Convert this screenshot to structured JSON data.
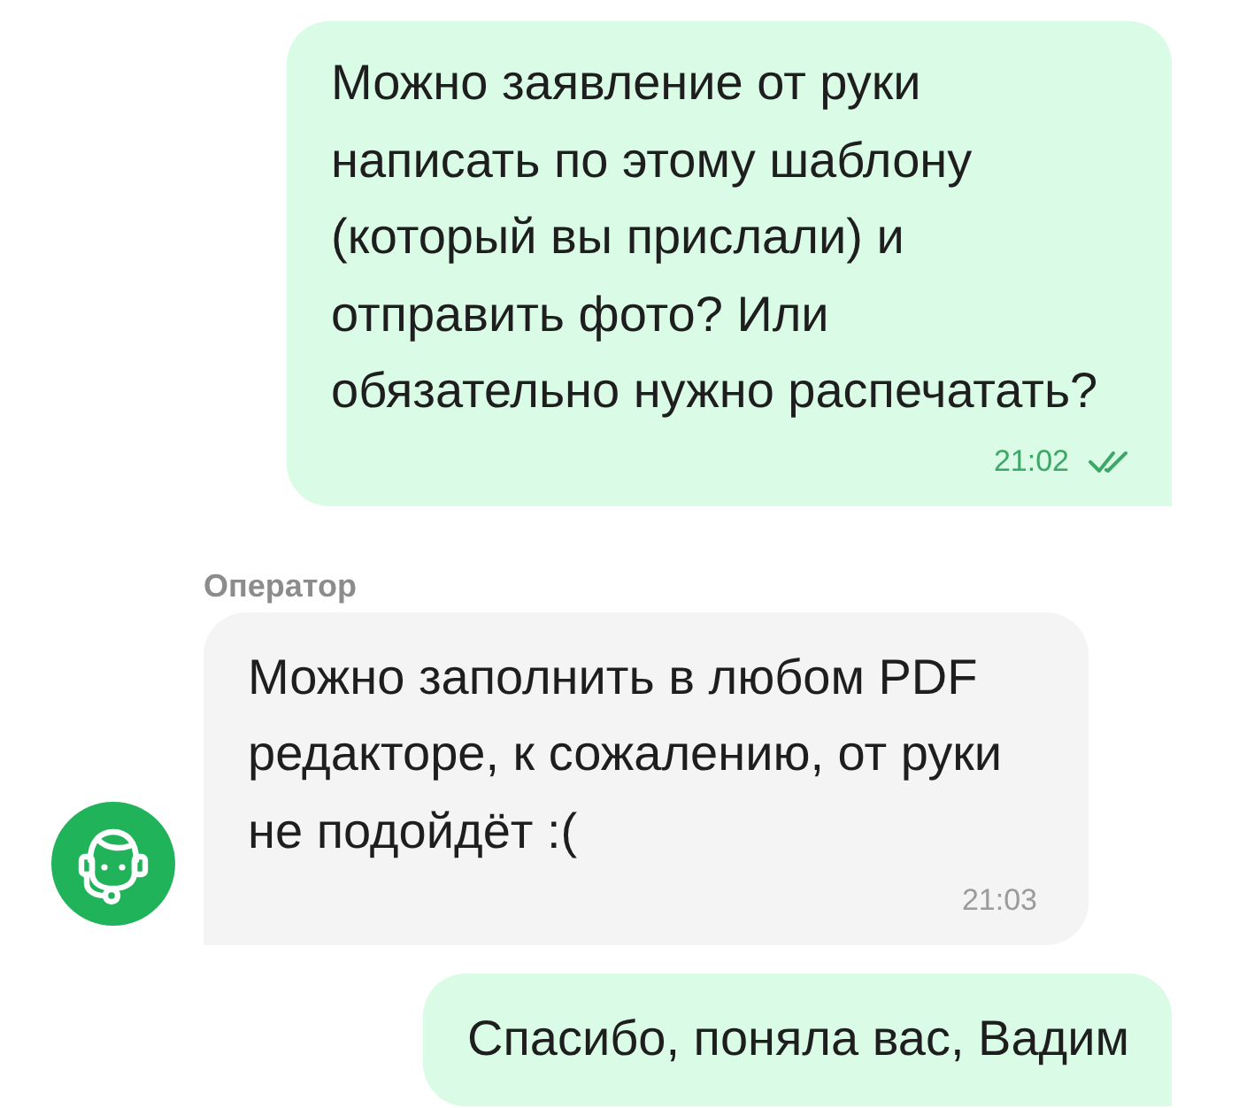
{
  "messages": [
    {
      "kind": "outgoing",
      "text": "Можно заявление от руки написать по этому шаблону (который вы прислали) и отправить фото? Или обязательно нужно распечатать?",
      "time": "21:02",
      "read": true
    },
    {
      "kind": "incoming",
      "sender": "Оператор",
      "text": "Можно заполнить в любом PDF редакторе, к сожалению, от руки не подойдёт :(",
      "time": "21:03"
    },
    {
      "kind": "outgoing",
      "text": "Спасибо, поняла вас, Вадим"
    }
  ]
}
